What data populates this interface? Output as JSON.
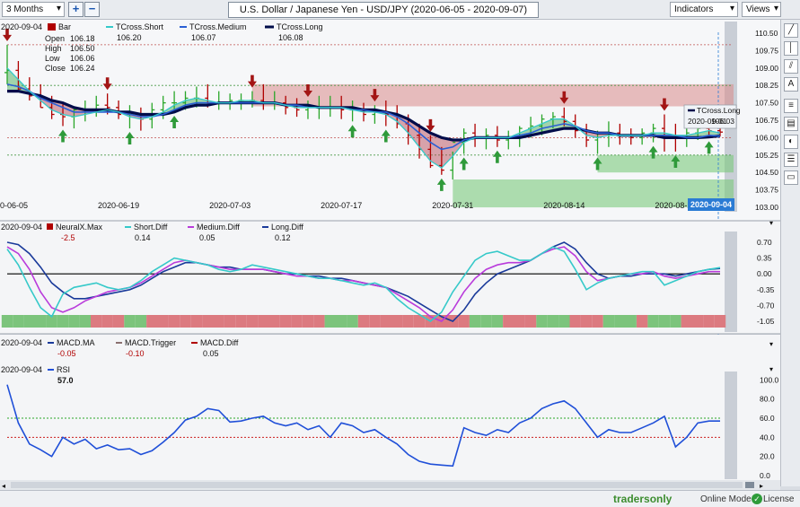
{
  "toolbar": {
    "period": "3 Months",
    "plus": "+",
    "minus": "−",
    "title": "U.S. Dollar / Japanese Yen - USD/JPY (2020-06-05 - 2020-09-07)",
    "indicators": "Indicators",
    "views": "Views"
  },
  "status": {
    "brand": "tradersonly",
    "mode": "Online Mode",
    "license": "License"
  },
  "colors": {
    "bar_up": "#2aa62a",
    "bar_down": "#b00000",
    "short": "#35c9c9",
    "medium": "#2a5fd4",
    "long": "#000c4a",
    "medium_diff": "#b93bdb",
    "long_diff": "#1a3a9a",
    "rsi": "#1f4fd8"
  },
  "chart_data": [
    {
      "type": "line",
      "panel": "price",
      "legend": {
        "date": "2020-09-04",
        "bar_label": "Bar",
        "open_label": "Open",
        "open": "106.18",
        "high_label": "High",
        "high": "106.50",
        "low_label": "Low",
        "low": "106.06",
        "close_label": "Close",
        "close": "106.24",
        "short_label": "TCross.Short",
        "short_value": "106.20",
        "medium_label": "TCross.Medium",
        "medium_value": "106.07",
        "long_label": "TCross.Long",
        "long_value": "106.08"
      },
      "tooltip": {
        "label": "TCross.Long",
        "date": "2020-09-01",
        "value": "106.03"
      },
      "x_labels": [
        "0-06-05",
        "2020-06-19",
        "2020-07-03",
        "2020-07-17",
        "2020-07-31",
        "2020-08-14",
        "2020-08-28"
      ],
      "x_current": "2020-09-04",
      "x_label_index": [
        0,
        10,
        20,
        30,
        40,
        50,
        60
      ],
      "ylim": [
        102.5,
        111
      ],
      "y_ticks": [
        "110.50",
        "109.75",
        "109.00",
        "108.25",
        "107.50",
        "106.75",
        "106.00",
        "105.25",
        "104.50",
        "103.75",
        "103.00"
      ],
      "opens": [
        108.8,
        108.9,
        108.1,
        107.8,
        107.3,
        107.0,
        106.9,
        107.2,
        107.2,
        107.4,
        107.3,
        107.0,
        107.0,
        106.8,
        107.2,
        107.5,
        107.5,
        107.7,
        107.7,
        107.5,
        107.5,
        107.6,
        107.6,
        107.6,
        107.5,
        107.5,
        107.3,
        107.2,
        107.3,
        107.3,
        107.3,
        107.2,
        107.2,
        107.0,
        107.1,
        107.0,
        106.6,
        106.1,
        105.5,
        104.8,
        104.6,
        105.8,
        106.2,
        106.0,
        106.1,
        105.9,
        106.0,
        106.4,
        106.5,
        106.8,
        106.9,
        106.7,
        106.3,
        105.9,
        106.2,
        106.2,
        106.1,
        106.0,
        106.2,
        106.4,
        106.1,
        106.0,
        106.2,
        106.4,
        106.3
      ],
      "highs": [
        110.0,
        109.3,
        108.6,
        108.3,
        107.8,
        107.5,
        107.3,
        107.6,
        107.8,
        107.9,
        107.6,
        107.4,
        107.3,
        107.5,
        107.8,
        108.0,
        108.0,
        108.2,
        108.3,
        108.0,
        107.9,
        107.9,
        108.0,
        108.3,
        108.0,
        107.8,
        107.7,
        107.6,
        107.8,
        107.8,
        107.8,
        107.6,
        107.5,
        107.4,
        107.6,
        107.4,
        107.0,
        106.6,
        106.1,
        105.6,
        105.4,
        106.4,
        106.6,
        106.4,
        106.5,
        106.3,
        106.5,
        106.9,
        107.0,
        107.1,
        107.3,
        107.0,
        106.6,
        106.3,
        106.7,
        106.6,
        106.4,
        106.4,
        106.6,
        107.0,
        106.6,
        106.4,
        106.6,
        106.6,
        106.5
      ],
      "lows": [
        108.3,
        108.0,
        107.6,
        107.3,
        106.8,
        106.5,
        106.4,
        106.7,
        106.9,
        107.0,
        106.8,
        106.4,
        106.3,
        106.4,
        106.8,
        107.1,
        107.2,
        107.3,
        107.3,
        107.2,
        107.2,
        107.2,
        107.3,
        107.2,
        107.2,
        107.0,
        106.9,
        106.8,
        106.8,
        106.9,
        106.8,
        106.7,
        106.7,
        106.6,
        106.5,
        106.4,
        105.7,
        105.1,
        104.7,
        104.4,
        104.2,
        105.3,
        105.6,
        105.5,
        105.6,
        105.5,
        105.6,
        106.0,
        106.1,
        106.4,
        106.5,
        106.0,
        105.6,
        105.3,
        105.6,
        105.7,
        105.7,
        105.7,
        105.8,
        105.4,
        105.4,
        105.6,
        105.9,
        106.0,
        106.06
      ],
      "closes": [
        108.9,
        108.1,
        107.8,
        107.3,
        107.0,
        106.9,
        107.2,
        107.2,
        107.4,
        107.3,
        107.0,
        107.0,
        106.8,
        107.2,
        107.5,
        107.5,
        107.7,
        107.7,
        107.5,
        107.5,
        107.6,
        107.6,
        107.6,
        107.5,
        107.5,
        107.3,
        107.2,
        107.3,
        107.3,
        107.3,
        107.2,
        107.2,
        107.0,
        107.1,
        107.0,
        106.6,
        106.1,
        105.5,
        104.8,
        104.6,
        105.8,
        106.2,
        106.0,
        106.1,
        105.9,
        106.0,
        106.4,
        106.5,
        106.8,
        106.9,
        106.7,
        106.3,
        105.9,
        106.2,
        106.2,
        106.1,
        106.0,
        106.2,
        106.4,
        106.1,
        106.0,
        106.2,
        106.4,
        106.3,
        106.24
      ],
      "series": [
        {
          "name": "TCross.Short",
          "values": [
            109.0,
            108.5,
            108.0,
            107.6,
            107.2,
            107.0,
            106.9,
            107.0,
            107.1,
            107.2,
            107.1,
            106.9,
            106.8,
            106.9,
            107.1,
            107.4,
            107.6,
            107.7,
            107.6,
            107.5,
            107.5,
            107.6,
            107.6,
            107.5,
            107.5,
            107.4,
            107.3,
            107.3,
            107.3,
            107.3,
            107.3,
            107.2,
            107.1,
            107.1,
            107.0,
            106.7,
            106.2,
            105.6,
            105.0,
            104.7,
            105.2,
            105.8,
            106.0,
            106.0,
            106.0,
            106.0,
            106.2,
            106.4,
            106.6,
            106.8,
            106.8,
            106.5,
            106.1,
            106.0,
            106.1,
            106.1,
            106.1,
            106.1,
            106.2,
            106.2,
            106.1,
            106.1,
            106.2,
            106.3,
            106.2
          ]
        },
        {
          "name": "TCross.Medium",
          "values": [
            108.3,
            108.2,
            108.0,
            107.7,
            107.5,
            107.3,
            107.1,
            107.1,
            107.1,
            107.1,
            107.1,
            107.0,
            106.9,
            106.9,
            107.0,
            107.2,
            107.4,
            107.5,
            107.5,
            107.5,
            107.5,
            107.5,
            107.5,
            107.5,
            107.5,
            107.4,
            107.4,
            107.3,
            107.3,
            107.3,
            107.3,
            107.2,
            107.2,
            107.1,
            107.1,
            106.9,
            106.6,
            106.2,
            105.8,
            105.5,
            105.6,
            105.9,
            106.0,
            106.0,
            106.0,
            106.0,
            106.1,
            106.2,
            106.4,
            106.5,
            106.6,
            106.5,
            106.3,
            106.2,
            106.2,
            106.1,
            106.1,
            106.1,
            106.1,
            106.1,
            106.1,
            106.0,
            106.0,
            106.1,
            106.07
          ]
        },
        {
          "name": "TCross.Long",
          "values": [
            108.0,
            108.0,
            107.9,
            107.8,
            107.6,
            107.5,
            107.3,
            107.2,
            107.2,
            107.2,
            107.1,
            107.1,
            107.0,
            107.0,
            107.0,
            107.1,
            107.3,
            107.4,
            107.4,
            107.5,
            107.5,
            107.5,
            107.5,
            107.5,
            107.5,
            107.4,
            107.4,
            107.4,
            107.3,
            107.3,
            107.3,
            107.3,
            107.2,
            107.2,
            107.1,
            107.0,
            106.8,
            106.5,
            106.2,
            106.0,
            105.9,
            105.9,
            106.0,
            106.0,
            106.0,
            106.0,
            106.0,
            106.1,
            106.2,
            106.3,
            106.4,
            106.4,
            106.3,
            106.2,
            106.2,
            106.1,
            106.1,
            106.1,
            106.1,
            106.0,
            106.0,
            106.0,
            106.0,
            106.03,
            106.08
          ]
        }
      ],
      "down_arrows": [
        0,
        9,
        22,
        27,
        33,
        38,
        50,
        59,
        73
      ],
      "up_arrows": [
        5,
        11,
        15,
        31,
        34,
        39,
        41,
        44,
        53,
        58,
        60,
        63
      ],
      "resistance_zones": [
        [
          107.35,
          108.3,
          22,
          64
        ]
      ],
      "support_zones": [
        [
          103.0,
          104.2,
          40,
          64
        ],
        [
          104.5,
          105.25,
          53,
          64
        ]
      ],
      "reference_lines": [
        110.0,
        108.25,
        106.0,
        105.25
      ]
    },
    {
      "type": "line",
      "panel": "diff",
      "legend": {
        "date": "2020-09-04",
        "neural_label": "NeuralX.Max",
        "neural_value": "-2.5",
        "short_label": "Short.Diff",
        "short_value": "0.14",
        "medium_label": "Medium.Diff",
        "medium_value": "0.05",
        "long_label": "Long.Diff",
        "long_value": "0.12"
      },
      "ylim": [
        -1.25,
        0.9
      ],
      "y_ticks": [
        "0.70",
        "0.35",
        "0.00",
        "-0.35",
        "-0.70",
        "-1.05"
      ],
      "series": [
        {
          "name": "Short.Diff",
          "values": [
            0.55,
            0.2,
            -0.3,
            -0.75,
            -0.95,
            -0.45,
            -0.3,
            -0.25,
            -0.2,
            -0.3,
            -0.35,
            -0.3,
            -0.15,
            0.05,
            0.2,
            0.35,
            0.3,
            0.25,
            0.2,
            0.1,
            0.05,
            0.1,
            0.2,
            0.15,
            0.1,
            0.05,
            0.0,
            -0.05,
            -0.1,
            -0.1,
            -0.15,
            -0.2,
            -0.25,
            -0.2,
            -0.3,
            -0.55,
            -0.75,
            -0.9,
            -1.05,
            -0.85,
            -0.4,
            -0.05,
            0.3,
            0.45,
            0.5,
            0.4,
            0.3,
            0.3,
            0.45,
            0.6,
            0.5,
            0.1,
            -0.35,
            -0.2,
            -0.1,
            -0.05,
            0.0,
            0.05,
            0.05,
            -0.25,
            -0.15,
            -0.05,
            0.05,
            0.1,
            0.14
          ]
        },
        {
          "name": "Medium.Diff",
          "values": [
            0.6,
            0.45,
            0.1,
            -0.4,
            -0.75,
            -0.85,
            -0.75,
            -0.6,
            -0.5,
            -0.4,
            -0.35,
            -0.3,
            -0.2,
            -0.05,
            0.1,
            0.25,
            0.3,
            0.25,
            0.2,
            0.15,
            0.1,
            0.1,
            0.1,
            0.1,
            0.05,
            0.0,
            -0.05,
            -0.05,
            -0.1,
            -0.1,
            -0.15,
            -0.15,
            -0.2,
            -0.25,
            -0.3,
            -0.45,
            -0.6,
            -0.75,
            -0.95,
            -1.05,
            -0.8,
            -0.4,
            -0.1,
            0.1,
            0.2,
            0.25,
            0.25,
            0.3,
            0.45,
            0.55,
            0.6,
            0.4,
            0.05,
            -0.15,
            -0.1,
            -0.05,
            0.0,
            0.0,
            0.05,
            -0.05,
            -0.1,
            -0.05,
            0.0,
            0.05,
            0.05
          ]
        },
        {
          "name": "Long.Diff",
          "values": [
            0.7,
            0.65,
            0.45,
            0.15,
            -0.2,
            -0.4,
            -0.55,
            -0.55,
            -0.5,
            -0.45,
            -0.4,
            -0.35,
            -0.25,
            -0.1,
            0.05,
            0.15,
            0.25,
            0.25,
            0.2,
            0.15,
            0.15,
            0.1,
            0.1,
            0.1,
            0.05,
            0.0,
            0.0,
            -0.05,
            -0.05,
            -0.1,
            -0.1,
            -0.15,
            -0.2,
            -0.25,
            -0.3,
            -0.4,
            -0.5,
            -0.65,
            -0.8,
            -0.95,
            -1.05,
            -0.8,
            -0.45,
            -0.2,
            0.0,
            0.1,
            0.2,
            0.3,
            0.45,
            0.6,
            0.7,
            0.55,
            0.25,
            0.0,
            -0.1,
            -0.05,
            -0.05,
            0.0,
            0.0,
            0.0,
            -0.05,
            0.0,
            0.05,
            0.1,
            0.12
          ]
        }
      ],
      "neural_strip": [
        "g",
        "g",
        "g",
        "g",
        "g",
        "g",
        "g",
        "g",
        "r",
        "r",
        "r",
        "g",
        "g",
        "r",
        "r",
        "r",
        "r",
        "r",
        "r",
        "r",
        "r",
        "r",
        "r",
        "r",
        "r",
        "r",
        "r",
        "r",
        "r",
        "g",
        "g",
        "g",
        "r",
        "r",
        "r",
        "r",
        "r",
        "r",
        "r",
        "r",
        "r",
        "r",
        "g",
        "g",
        "g",
        "r",
        "r",
        "r",
        "g",
        "g",
        "g",
        "r",
        "r",
        "r",
        "g",
        "g",
        "g",
        "r",
        "g",
        "g",
        "g",
        "r",
        "r",
        "r",
        "r"
      ]
    },
    {
      "type": "line",
      "panel": "macd",
      "legend": {
        "date": "2020-09-04",
        "ma_label": "MACD.MA",
        "ma_value": "-0.05",
        "trigger_label": "MACD.Trigger",
        "trigger_value": "-0.10",
        "diff_label": "MACD.Diff",
        "diff_value": "0.05"
      }
    },
    {
      "type": "line",
      "panel": "rsi",
      "legend": {
        "date": "2020-09-04",
        "label": "RSI",
        "value": "57.0"
      },
      "ylim": [
        0,
        105
      ],
      "y_ticks": [
        "100.0",
        "80.0",
        "60.0",
        "40.0",
        "20.0",
        "0.0"
      ],
      "series": [
        {
          "name": "RSI",
          "values": [
            95,
            55,
            33,
            27,
            20,
            40,
            33,
            38,
            28,
            32,
            27,
            28,
            22,
            26,
            35,
            45,
            58,
            62,
            70,
            68,
            56,
            57,
            60,
            62,
            55,
            52,
            55,
            48,
            52,
            40,
            55,
            52,
            45,
            48,
            40,
            33,
            22,
            15,
            12,
            11,
            10,
            50,
            45,
            42,
            48,
            45,
            55,
            60,
            70,
            75,
            78,
            70,
            55,
            40,
            48,
            45,
            45,
            50,
            55,
            62,
            30,
            40,
            55,
            57,
            57
          ]
        }
      ],
      "levels": [
        60,
        40
      ]
    }
  ]
}
